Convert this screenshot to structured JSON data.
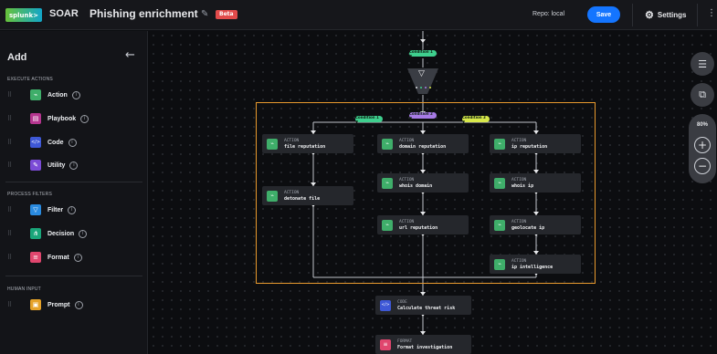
{
  "header": {
    "logo_text": "splunk>",
    "app_name": "SOAR",
    "playbook_name": "Phishing enrichment",
    "beta_badge": "Beta",
    "repo_label": "Repo: local",
    "save_label": "Save",
    "settings_label": "Settings"
  },
  "sidebar": {
    "title": "Add",
    "sections": [
      {
        "label": "EXECUTE ACTIONS"
      },
      {
        "label": "PROCESS FILTERS"
      },
      {
        "label": "HUMAN INPUT"
      }
    ],
    "items": [
      {
        "label": "Action",
        "icon": "action-icon",
        "color": "#3fae6a"
      },
      {
        "label": "Playbook",
        "icon": "playbook-icon",
        "color": "#b5358f"
      },
      {
        "label": "Code",
        "icon": "code-icon",
        "color": "#3e58d6"
      },
      {
        "label": "Utility",
        "icon": "utility-icon",
        "color": "#7b4bd6"
      },
      {
        "label": "Filter",
        "icon": "filter-icon",
        "color": "#2a8be0"
      },
      {
        "label": "Decision",
        "icon": "decision-icon",
        "color": "#1aa67a"
      },
      {
        "label": "Format",
        "icon": "format-icon",
        "color": "#e0466e"
      },
      {
        "label": "Prompt",
        "icon": "prompt-icon",
        "color": "#e6a229"
      }
    ]
  },
  "canvas": {
    "conditions": [
      {
        "label": "Condition 1 ▼",
        "color": "#3ecf8e"
      },
      {
        "label": "Condition 1 ▼",
        "color": "#3ecf8e"
      },
      {
        "label": "Condition 2 ▼",
        "color": "#a77be6"
      },
      {
        "label": "Condition 3 ▼",
        "color": "#d8e84a"
      }
    ],
    "nodes": [
      {
        "kind": "ACTION",
        "name": "file reputation"
      },
      {
        "kind": "ACTION",
        "name": "detonate file"
      },
      {
        "kind": "ACTION",
        "name": "domain reputation"
      },
      {
        "kind": "ACTION",
        "name": "whois domain"
      },
      {
        "kind": "ACTION",
        "name": "url reputation"
      },
      {
        "kind": "ACTION",
        "name": "ip reputation"
      },
      {
        "kind": "ACTION",
        "name": "whois ip"
      },
      {
        "kind": "ACTION",
        "name": "geolocate ip"
      },
      {
        "kind": "ACTION",
        "name": "ip intelligence"
      },
      {
        "kind": "CODE",
        "name": "Calculate threat risk"
      },
      {
        "kind": "FORMAT",
        "name": "Format investigation"
      }
    ],
    "zoom": "80%",
    "colors": {
      "action": "#3fae6a",
      "code": "#3e58d6",
      "format": "#e0466e",
      "highlight": "#e99a2e"
    }
  }
}
